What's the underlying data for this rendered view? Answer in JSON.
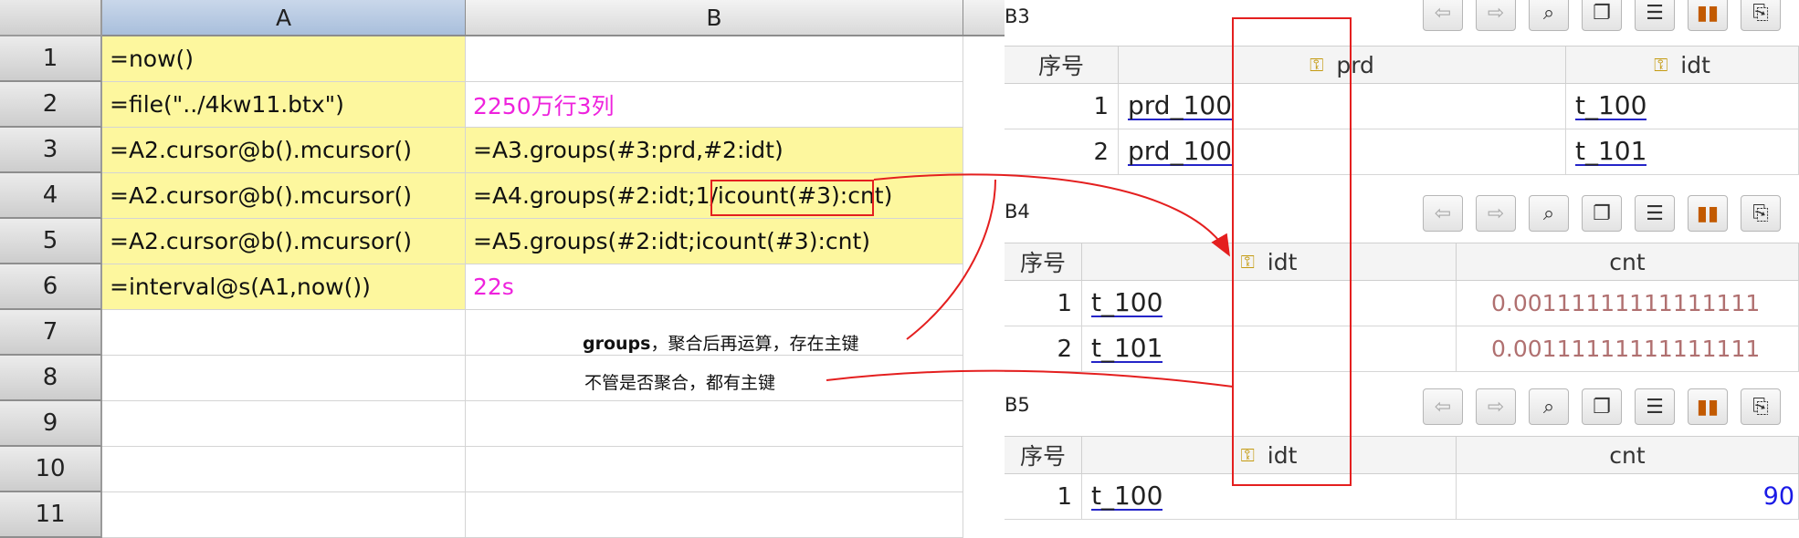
{
  "grid": {
    "columns": [
      "A",
      "B"
    ],
    "rows": [
      {
        "num": "1",
        "a": "=now()",
        "b": ""
      },
      {
        "num": "2",
        "a": "=file(\"../4kw11.btx\")",
        "b": "2250万行3列"
      },
      {
        "num": "3",
        "a": "=A2.cursor@b().mcursor()",
        "b": "=A3.groups(#3:prd,#2:idt)"
      },
      {
        "num": "4",
        "a": "=A2.cursor@b().mcursor()",
        "b": "=A4.groups(#2:idt;1/icount(#3):cnt)"
      },
      {
        "num": "5",
        "a": "=A2.cursor@b().mcursor()",
        "b": "=A5.groups(#2:idt;icount(#3):cnt)"
      },
      {
        "num": "6",
        "a": "=interval@s(A1,now())",
        "b": "22s"
      },
      {
        "num": "7",
        "a": "",
        "b": ""
      },
      {
        "num": "8",
        "a": "",
        "b": ""
      },
      {
        "num": "9",
        "a": "",
        "b": ""
      },
      {
        "num": "10",
        "a": "",
        "b": ""
      },
      {
        "num": "11",
        "a": "",
        "b": ""
      }
    ],
    "notes": {
      "note1_bold": "groups",
      "note1_rest": "，聚合后再运算，存在主键",
      "note2": "不管是否聚合，都有主键"
    }
  },
  "panels": {
    "b3": {
      "title": "B3",
      "col_index": "序号",
      "col1": "prd",
      "col2": "idt",
      "rows": [
        {
          "idx": "1",
          "c1": "prd_100",
          "c2": "t_100"
        },
        {
          "idx": "2",
          "c1": "prd_100",
          "c2": "t_101"
        }
      ]
    },
    "b4": {
      "title": "B4",
      "col_index": "序号",
      "col1": "idt",
      "col2": "cnt",
      "rows": [
        {
          "idx": "1",
          "c1": "t_100",
          "c2": "0.00111111111111111"
        },
        {
          "idx": "2",
          "c1": "t_101",
          "c2": "0.00111111111111111"
        }
      ]
    },
    "b5": {
      "title": "B5",
      "col_index": "序号",
      "col1": "idt",
      "col2": "cnt",
      "rows": [
        {
          "idx": "1",
          "c1": "t_100",
          "c2": "90"
        }
      ]
    },
    "toolbar_icons": [
      "back-icon",
      "forward-icon",
      "magnify-icon",
      "copy-icon",
      "list-icon",
      "chart-icon",
      "export-icon"
    ]
  },
  "colors": {
    "formula_cell": "#fdf79e",
    "constant_value": "#ee22dd",
    "annotation": "#e41f1f",
    "link_underline": "#2424c8",
    "value_blue": "#1a1ae6"
  }
}
